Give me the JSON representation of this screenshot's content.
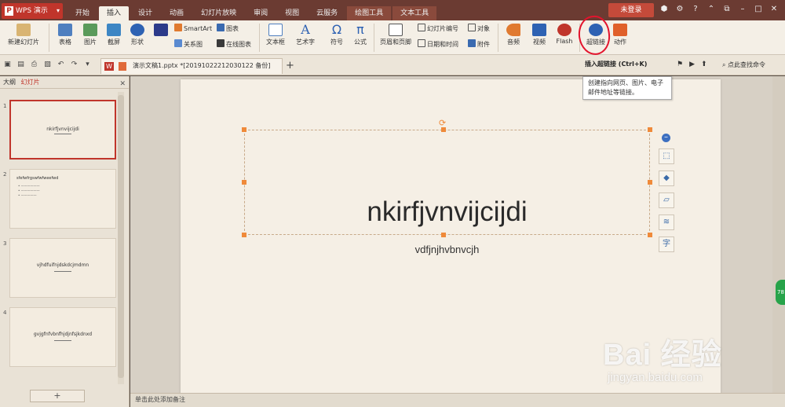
{
  "app": {
    "name": "WPS 演示",
    "logo_letter": "P"
  },
  "tabs": [
    "开始",
    "插入",
    "设计",
    "动画",
    "幻灯片放映",
    "审阅",
    "视图",
    "云服务",
    "绘图工具",
    "文本工具"
  ],
  "login": "未登录",
  "ribbon": {
    "new_slide": "新建幻灯片",
    "table": "表格",
    "picture": "图片",
    "screenshot": "截屏",
    "shape": "形状",
    "smartart": "SmartArt",
    "chart": "图表",
    "relation": "关系图",
    "online_chart": "在线图表",
    "textbox": "文本框",
    "wordart": "艺术字",
    "symbol": "符号",
    "formula": "公式",
    "header_footer": "页眉和页脚",
    "slide_number": "幻灯片编号",
    "object": "对象",
    "datetime": "日期和时间",
    "attachment": "附件",
    "audio": "音频",
    "video": "视频",
    "flash": "Flash",
    "hyperlink": "超链接",
    "action": "动作"
  },
  "tooltip": {
    "title": "插入超链接 (Ctrl+K)",
    "body": "创建指向网页、图片、电子邮件地址等链接。"
  },
  "doc_tab": "演示文稿1.pptx *[20191022212030122 备份]",
  "find_command": "点此查找命令",
  "panel": {
    "outline": "大纲",
    "slides": "幻灯片"
  },
  "thumbnails": [
    {
      "num": "1",
      "title": "nkirfjvnvijcijdi"
    },
    {
      "num": "2",
      "title": "sfefwfrgswfwfweefwd"
    },
    {
      "num": "3",
      "title": "vjhdfuifnjdskdcjmdmn"
    },
    {
      "num": "4",
      "title": "gvjgfnfvbnfhjdjnfsjkdnxd"
    }
  ],
  "slide": {
    "title": "nkirfjvnvijcijdi",
    "subtitle": "vdfjnjhvbnvcjh"
  },
  "notes_placeholder": "单击此处添加备注",
  "side_bubble": "78",
  "watermark": {
    "top": "Bai 经验",
    "bottom": "jingyan.baidu.com"
  },
  "colors": {
    "accent": "#c0352b",
    "titlebar": "#6b3b32",
    "handles": "#ef8a3a",
    "annotation": "#e3142d"
  }
}
